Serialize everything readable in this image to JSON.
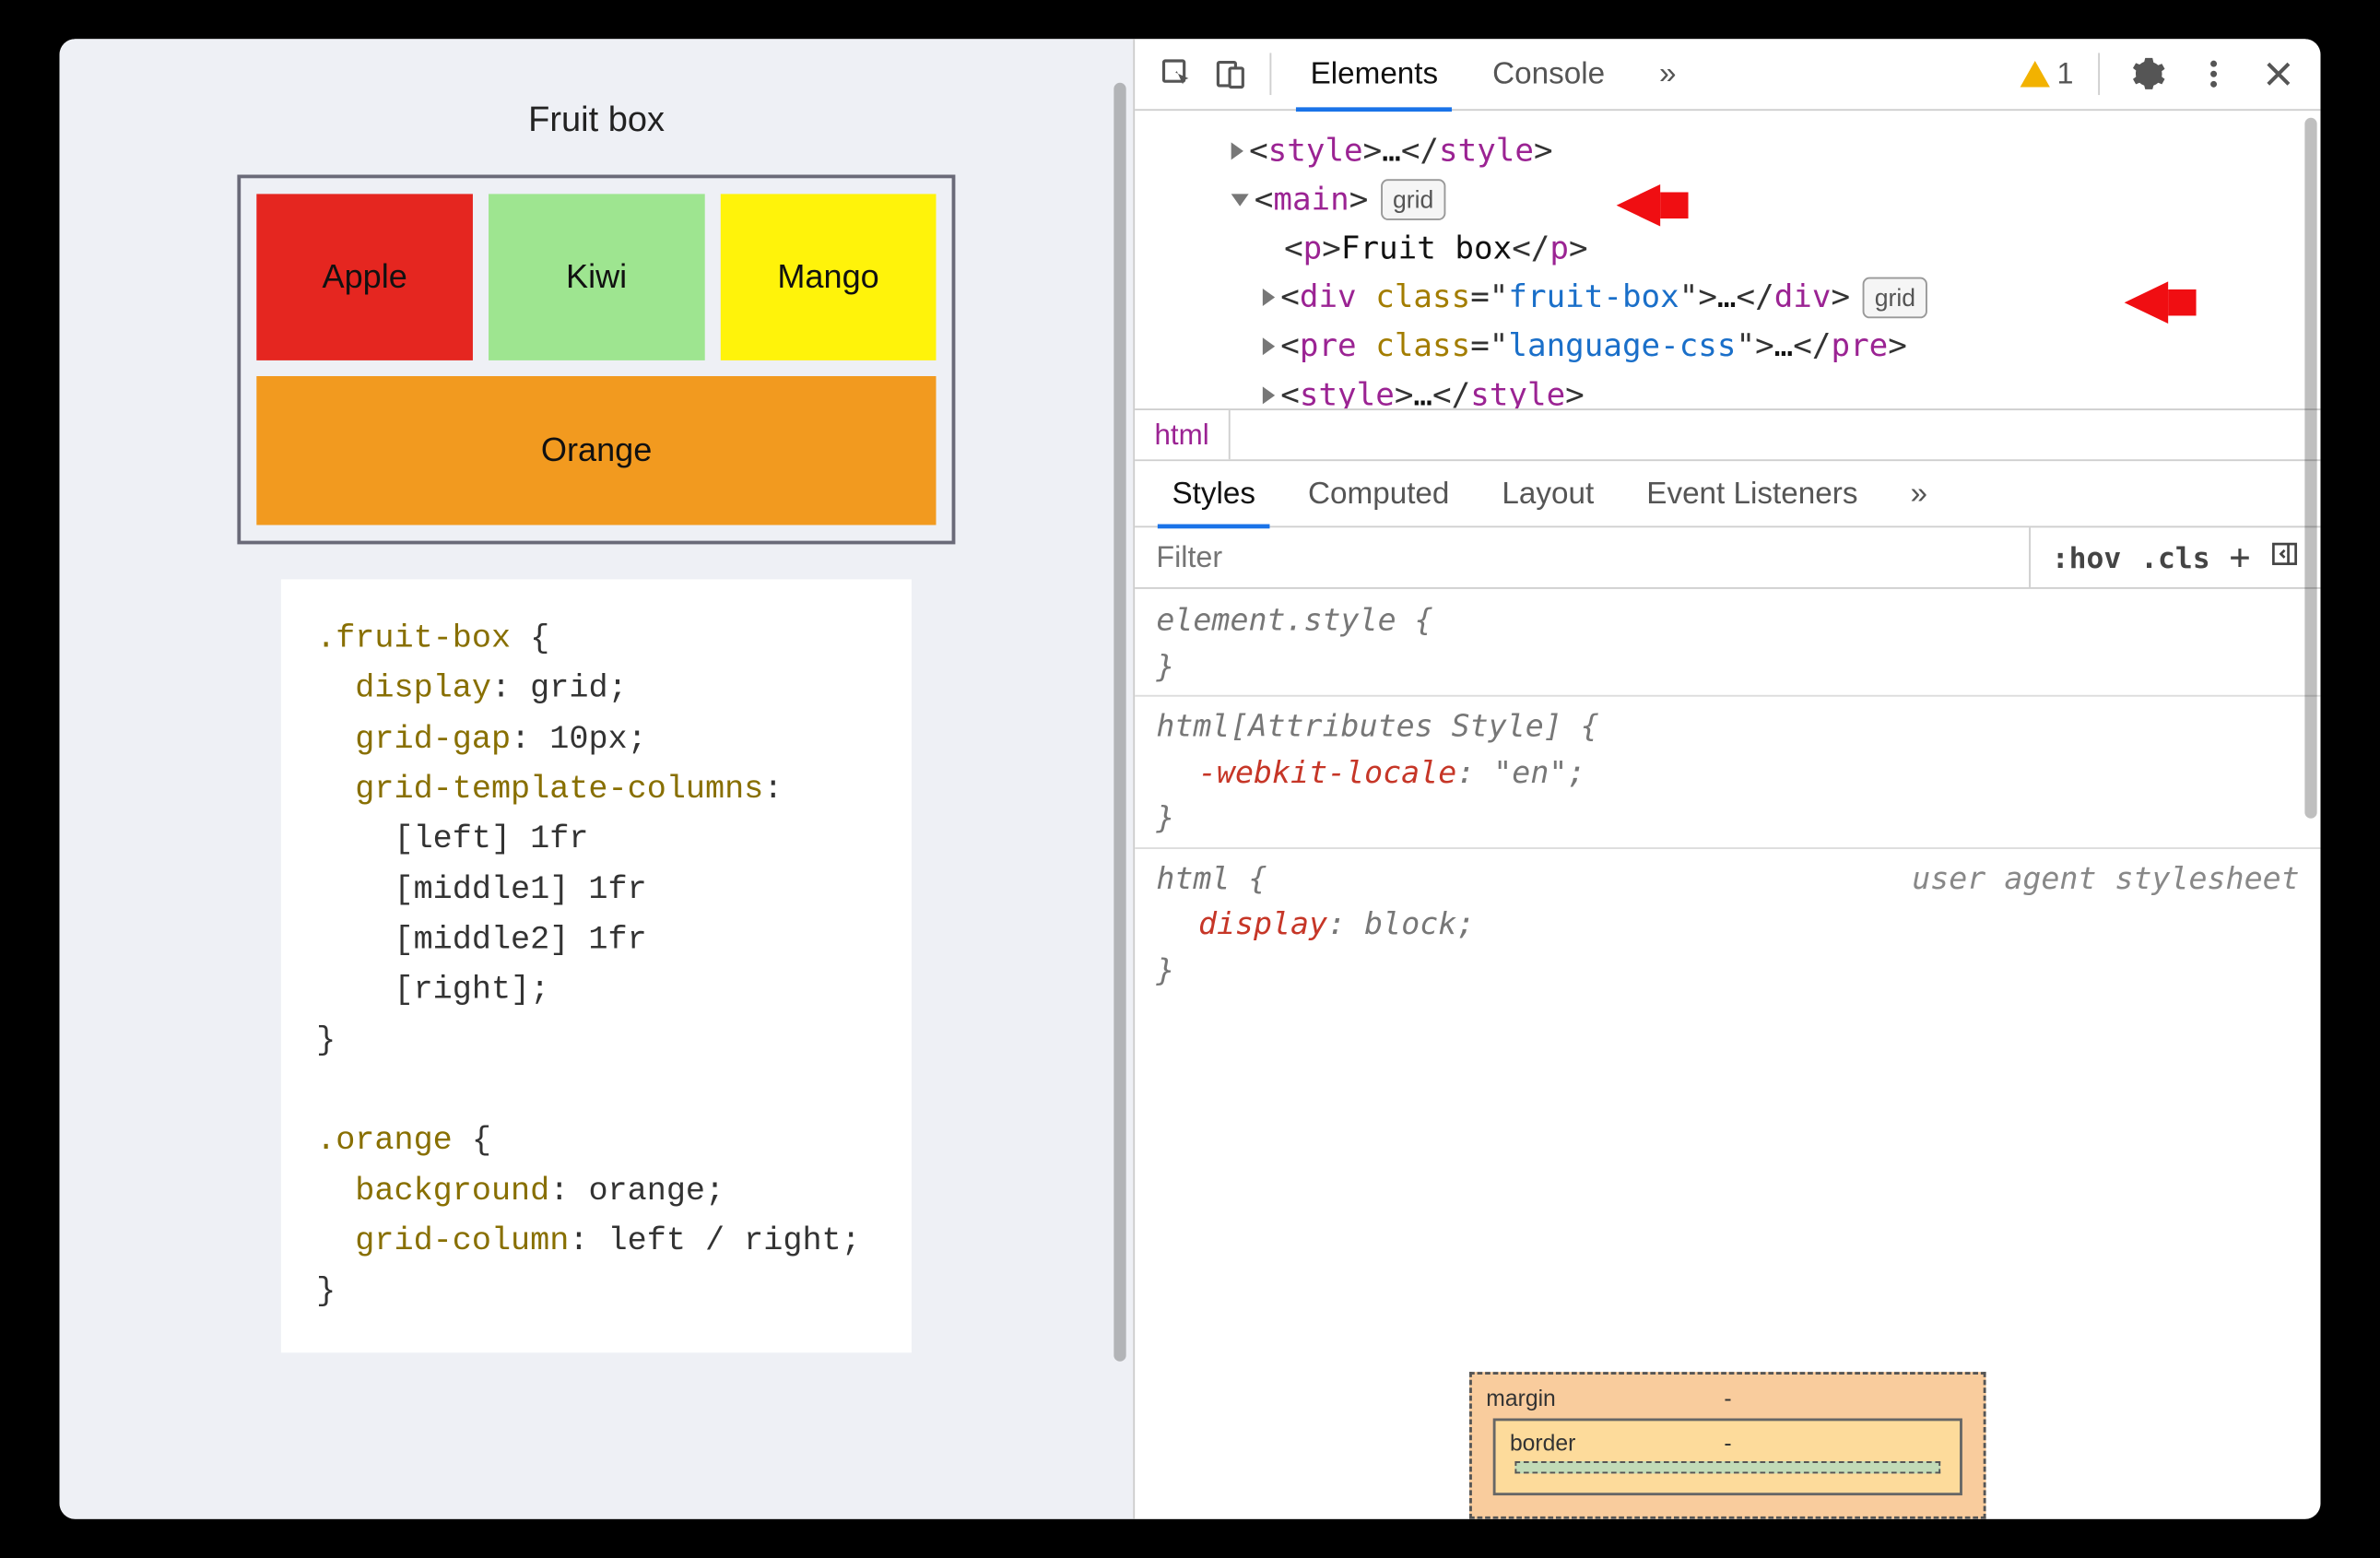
{
  "left": {
    "title": "Fruit box",
    "fruits": {
      "apple": "Apple",
      "kiwi": "Kiwi",
      "mango": "Mango",
      "orange": "Orange"
    },
    "css_code": ".fruit-box {\n  display: grid;\n  grid-gap: 10px;\n  grid-template-columns:\n    [left] 1fr\n    [middle1] 1fr\n    [middle2] 1fr\n    [right];\n}\n\n.orange {\n  background: orange;\n  grid-column: left / right;\n}"
  },
  "devtools": {
    "tabs": {
      "elements": "Elements",
      "console": "Console",
      "more": "»"
    },
    "warning_count": "1",
    "tree": {
      "line1": {
        "tag": "style",
        "ellipsis": "…"
      },
      "line2": {
        "tag": "main",
        "badge": "grid"
      },
      "line3": {
        "tag": "p",
        "text": "Fruit box"
      },
      "line4": {
        "tag": "div",
        "attr": "class",
        "val": "fruit-box",
        "ellipsis": "…",
        "badge": "grid"
      },
      "line5": {
        "tag": "pre",
        "attr": "class",
        "val": "language-css",
        "ellipsis": "…"
      },
      "line6": {
        "tag": "style",
        "ellipsis": "…"
      }
    },
    "breadcrumb": {
      "html": "html"
    },
    "styles_tabs": {
      "styles": "Styles",
      "computed": "Computed",
      "layout": "Layout",
      "listeners": "Event Listeners",
      "more": "»"
    },
    "filter": {
      "placeholder": "Filter",
      "hov": ":hov",
      "cls": ".cls",
      "plus": "+"
    },
    "rules": {
      "r1_sel": "element.style {",
      "r1_close": "}",
      "r2_sel": "html[Attributes Style] {",
      "r2_prop": "-webkit-locale",
      "r2_val": "\"en\"",
      "r2_close": "}",
      "r3_sel": "html {",
      "r3_source": "user agent stylesheet",
      "r3_prop": "display",
      "r3_val": "block",
      "r3_close": "}"
    },
    "box_model": {
      "margin_label": "margin",
      "margin_dash": "-",
      "border_label": "border",
      "border_dash": "-"
    }
  }
}
